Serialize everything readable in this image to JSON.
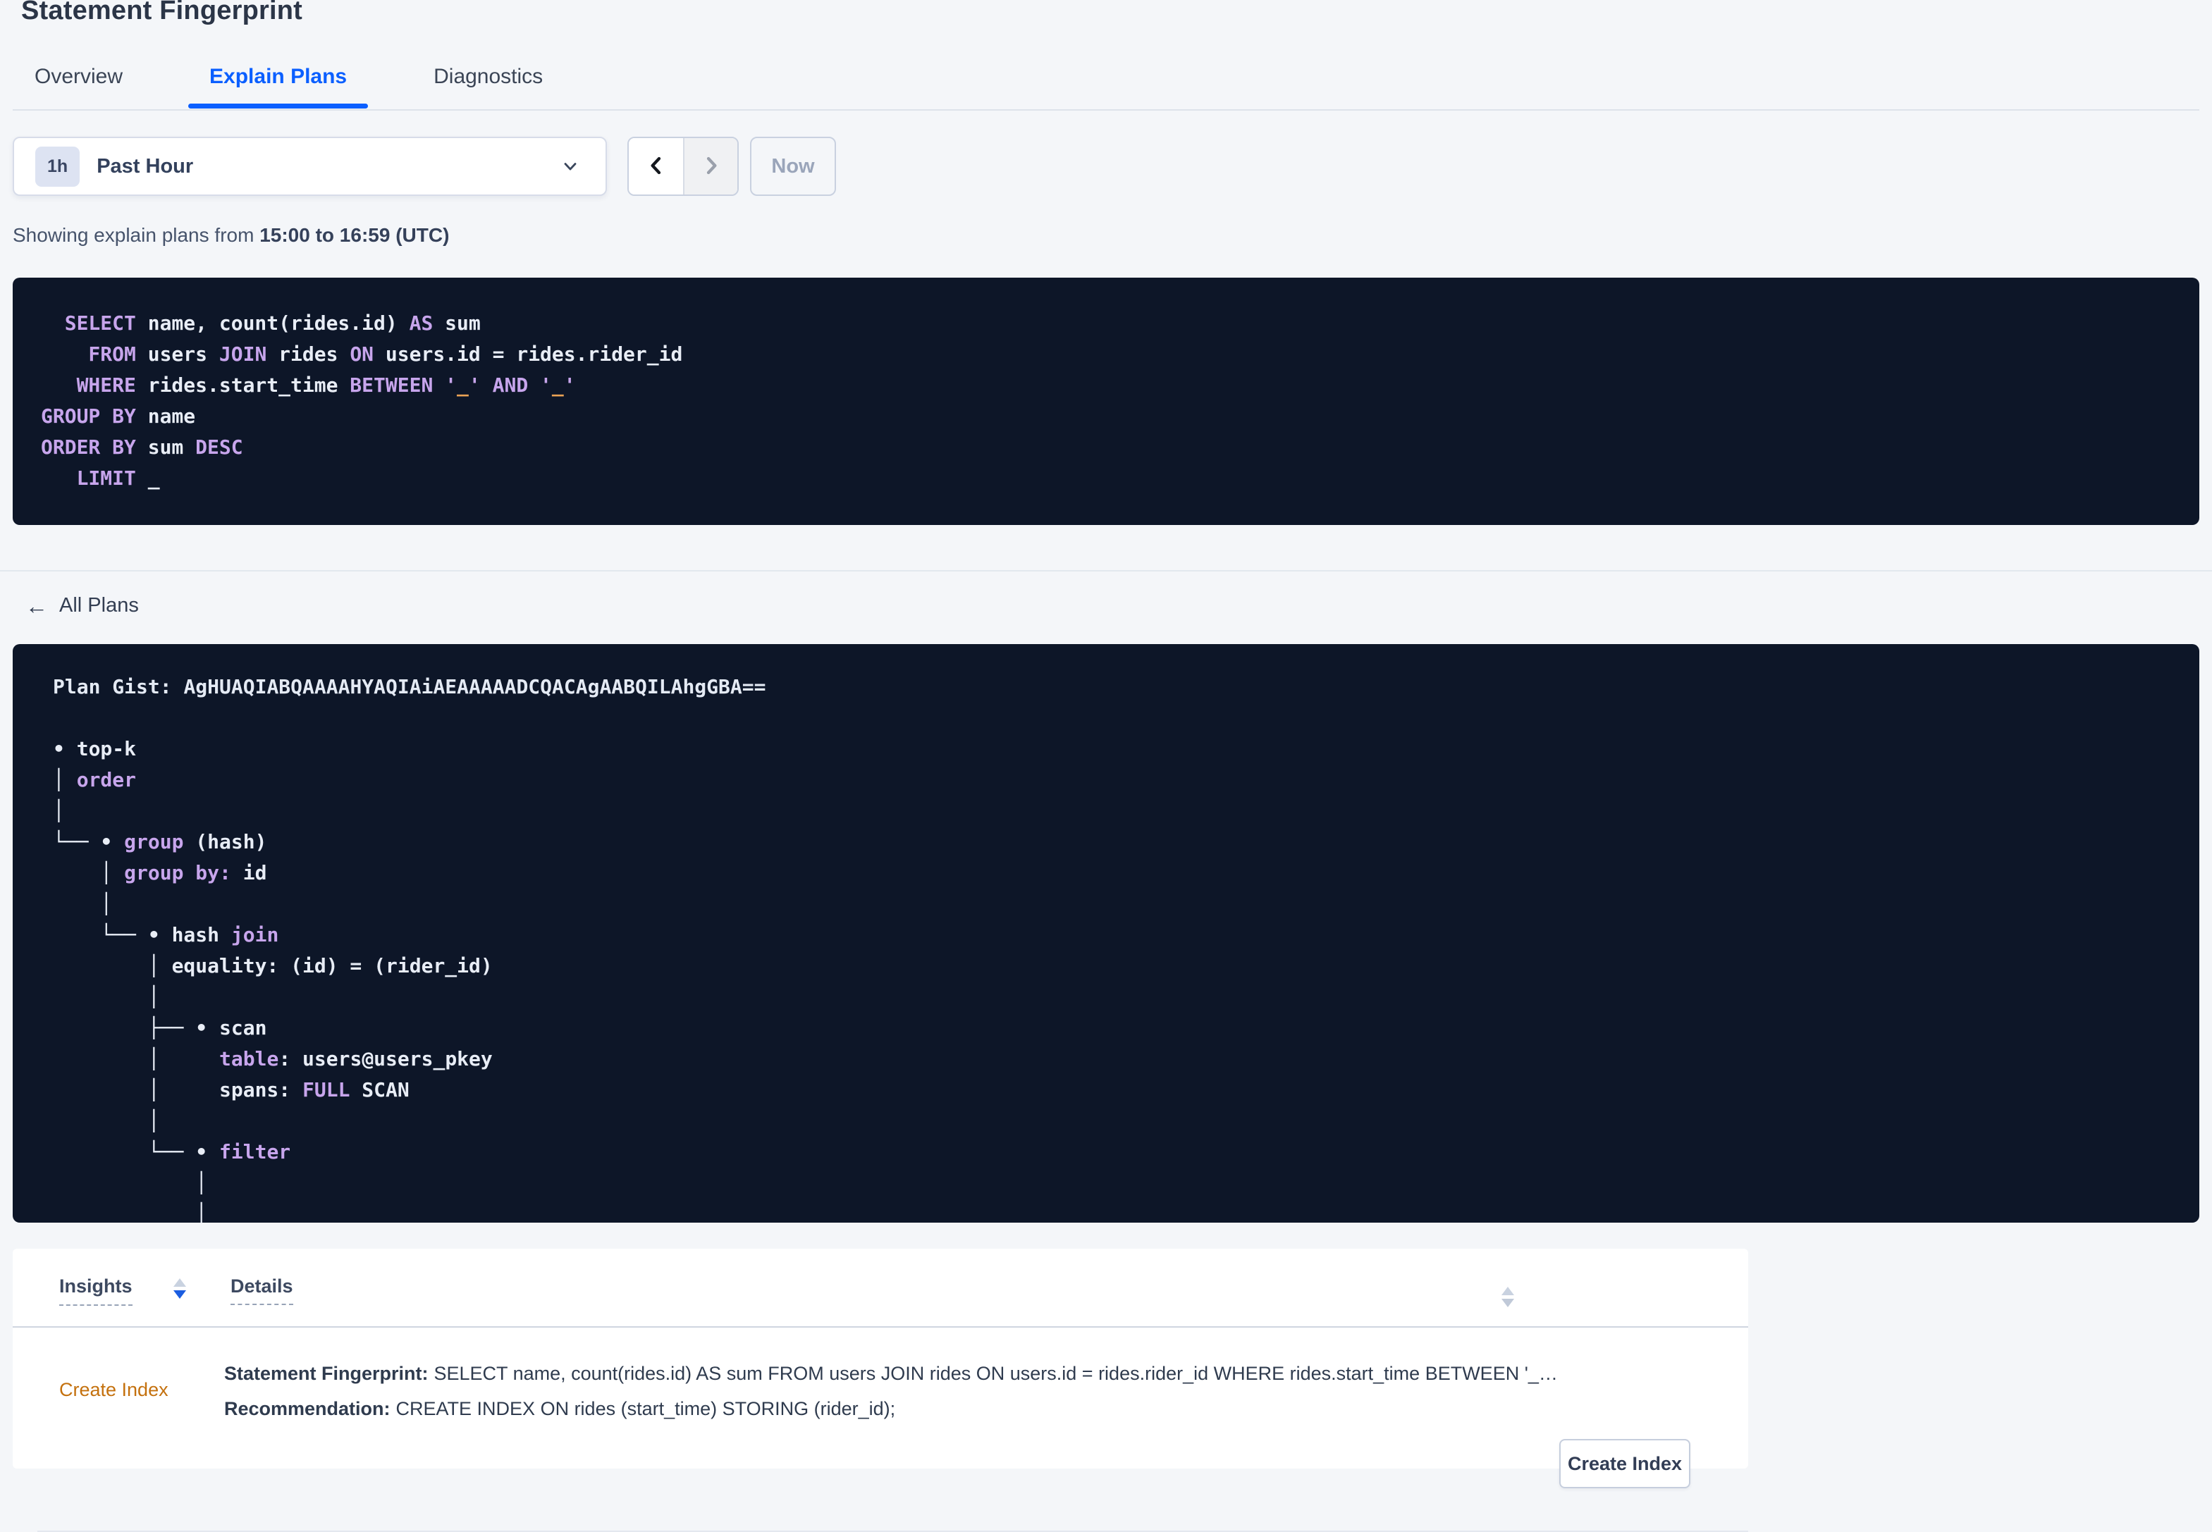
{
  "page": {
    "title": "Statement Fingerprint"
  },
  "tabs": [
    {
      "label": "Overview",
      "active": false
    },
    {
      "label": "Explain Plans",
      "active": true
    },
    {
      "label": "Diagnostics",
      "active": false
    }
  ],
  "time_picker": {
    "badge": "1h",
    "selected": "Past Hour",
    "now_label": "Now"
  },
  "summary": {
    "prefix": "Showing explain plans from ",
    "range": "15:00 to 16:59 (UTC)"
  },
  "sql": {
    "lines": [
      [
        [
          "kw",
          "  SELECT"
        ],
        [
          "txt",
          " name, count(rides.id) "
        ],
        [
          "kw",
          "AS"
        ],
        [
          "txt",
          " sum"
        ]
      ],
      [
        [
          "kw",
          "    FROM"
        ],
        [
          "txt",
          " users "
        ],
        [
          "kw",
          "JOIN"
        ],
        [
          "txt",
          " rides "
        ],
        [
          "kw",
          "ON"
        ],
        [
          "txt",
          " users.id = rides.rider_id"
        ]
      ],
      [
        [
          "kw",
          "   WHERE"
        ],
        [
          "txt",
          " rides.start_time "
        ],
        [
          "kw",
          "BETWEEN"
        ],
        [
          "txt",
          " "
        ],
        [
          "kw",
          "'"
        ],
        [
          "lit",
          "_"
        ],
        [
          "kw",
          "'"
        ],
        [
          "txt",
          " "
        ],
        [
          "kw",
          "AND"
        ],
        [
          "txt",
          " "
        ],
        [
          "kw",
          "'"
        ],
        [
          "lit",
          "_"
        ],
        [
          "kw",
          "'"
        ]
      ],
      [
        [
          "kw",
          "GROUP BY"
        ],
        [
          "txt",
          " name"
        ]
      ],
      [
        [
          "kw",
          "ORDER BY"
        ],
        [
          "txt",
          " sum "
        ],
        [
          "kw",
          "DESC"
        ]
      ],
      [
        [
          "kw",
          "   LIMIT"
        ],
        [
          "txt",
          " _"
        ]
      ]
    ]
  },
  "all_plans": {
    "label": "All Plans"
  },
  "plan": {
    "gist_prefix": "Plan Gist: ",
    "gist": "AgHUAQIABQAAAAHYAQIAiAEAAAAADCQACAgAABQILAhgGBA==",
    "tree": [
      [
        [
          "txt",
          "• top-k"
        ]
      ],
      [
        [
          "txt",
          "│ "
        ],
        [
          "kw",
          "order"
        ]
      ],
      [
        [
          "txt",
          "│"
        ]
      ],
      [
        [
          "txt",
          "└── • "
        ],
        [
          "kw",
          "group"
        ],
        [
          "txt",
          " (hash)"
        ]
      ],
      [
        [
          "txt",
          "    │ "
        ],
        [
          "kw",
          "group by:"
        ],
        [
          "txt",
          " id"
        ]
      ],
      [
        [
          "txt",
          "    │"
        ]
      ],
      [
        [
          "txt",
          "    └── • hash "
        ],
        [
          "kw",
          "join"
        ]
      ],
      [
        [
          "txt",
          "        │ equality: (id) = (rider_id)"
        ]
      ],
      [
        [
          "txt",
          "        │"
        ]
      ],
      [
        [
          "txt",
          "        ├── • scan"
        ]
      ],
      [
        [
          "txt",
          "        │     "
        ],
        [
          "kw",
          "table"
        ],
        [
          "txt",
          ": users@users_pkey"
        ]
      ],
      [
        [
          "txt",
          "        │     spans: "
        ],
        [
          "kw",
          "FULL"
        ],
        [
          "txt",
          " SCAN"
        ]
      ],
      [
        [
          "txt",
          "        │"
        ]
      ],
      [
        [
          "txt",
          "        └── • "
        ],
        [
          "kw",
          "filter"
        ]
      ],
      [
        [
          "txt",
          "            │"
        ]
      ],
      [
        [
          "txt",
          "            │"
        ]
      ]
    ]
  },
  "insights_table": {
    "headers": [
      {
        "label": "Insights",
        "sort": "desc"
      },
      {
        "label": "Details",
        "sort": "none"
      }
    ],
    "rows": [
      {
        "insight": "Create Index",
        "details": [
          {
            "label": "Statement Fingerprint:",
            "text": "SELECT name, count(rides.id) AS sum FROM users JOIN rides ON users.id = rides.rider_id WHERE rides.start_time BETWEEN '_…"
          },
          {
            "label": "Recommendation:",
            "text": "CREATE INDEX ON rides (start_time) STORING (rider_id);"
          }
        ],
        "action_label": "Create Index"
      }
    ]
  },
  "colors": {
    "accent_blue": "#0b5fff",
    "panel_bg": "#0d1628",
    "keyword_purple": "#c7a5ec",
    "literal_orange": "#eba355",
    "code_text": "#e8edf6",
    "insight_orange": "#c4710e",
    "page_bg": "#f4f6f9"
  }
}
